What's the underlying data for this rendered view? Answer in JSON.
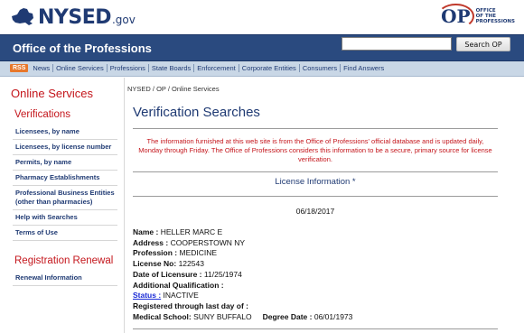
{
  "logos": {
    "nysed_main": "NYSED",
    "nysed_gov": ".gov",
    "op_mark": "OP",
    "op_subtitle": [
      "OFFICE",
      "OF THE",
      "PROFESSIONS"
    ]
  },
  "header": {
    "title": "Office of the Professions",
    "search_placeholder": "",
    "search_button": "Search OP"
  },
  "nav": {
    "rss": "RSS",
    "items": [
      "News",
      "Online Services",
      "Professions",
      "State Boards",
      "Enforcement",
      "Corporate Entities",
      "Consumers",
      "Find Answers"
    ]
  },
  "sidebar": {
    "section_title": "Online Services",
    "verifications_title": "Verifications",
    "verifications": [
      "Licensees, by name",
      "Licensees, by license number",
      "Permits, by name",
      "Pharmacy Establishments",
      "Professional Business Entities (other than pharmacies)",
      "Help with Searches",
      "Terms of Use"
    ],
    "renewal_title": "Registration Renewal",
    "renewal_items": [
      "Renewal Information"
    ]
  },
  "breadcrumb": "NYSED / OP / Online Services",
  "main": {
    "title": "Verification Searches",
    "disclaimer": "The information furnished at this web site is from the Office of Professions' official database and is updated daily, Monday through Friday. The Office of Professions considers this information to be a secure, primary source for license verification.",
    "license_info_heading": "License Information *",
    "date": "06/18/2017",
    "fields": {
      "name_label": "Name :",
      "name_value": "HELLER MARC E",
      "address_label": "Address :",
      "address_value": "COOPERSTOWN NY",
      "profession_label": "Profession :",
      "profession_value": "MEDICINE",
      "license_label": "License No:",
      "license_value": "122543",
      "date_licensure_label": "Date of Licensure :",
      "date_licensure_value": "11/25/1974",
      "additional_label": "Additional Qualification :",
      "status_label": "Status :",
      "status_value": "INACTIVE",
      "registered_label": "Registered through last day of :",
      "medical_school_label": "Medical School:",
      "medical_school_value": "SUNY BUFFALO",
      "degree_date_label": "Degree Date :",
      "degree_date_value": "06/01/1973"
    }
  },
  "colors": {
    "header_blue": "#2a4a7f",
    "nav_bg": "#c9d7e6",
    "accent_red": "#c4161c",
    "link_blue": "#1f3a73"
  }
}
